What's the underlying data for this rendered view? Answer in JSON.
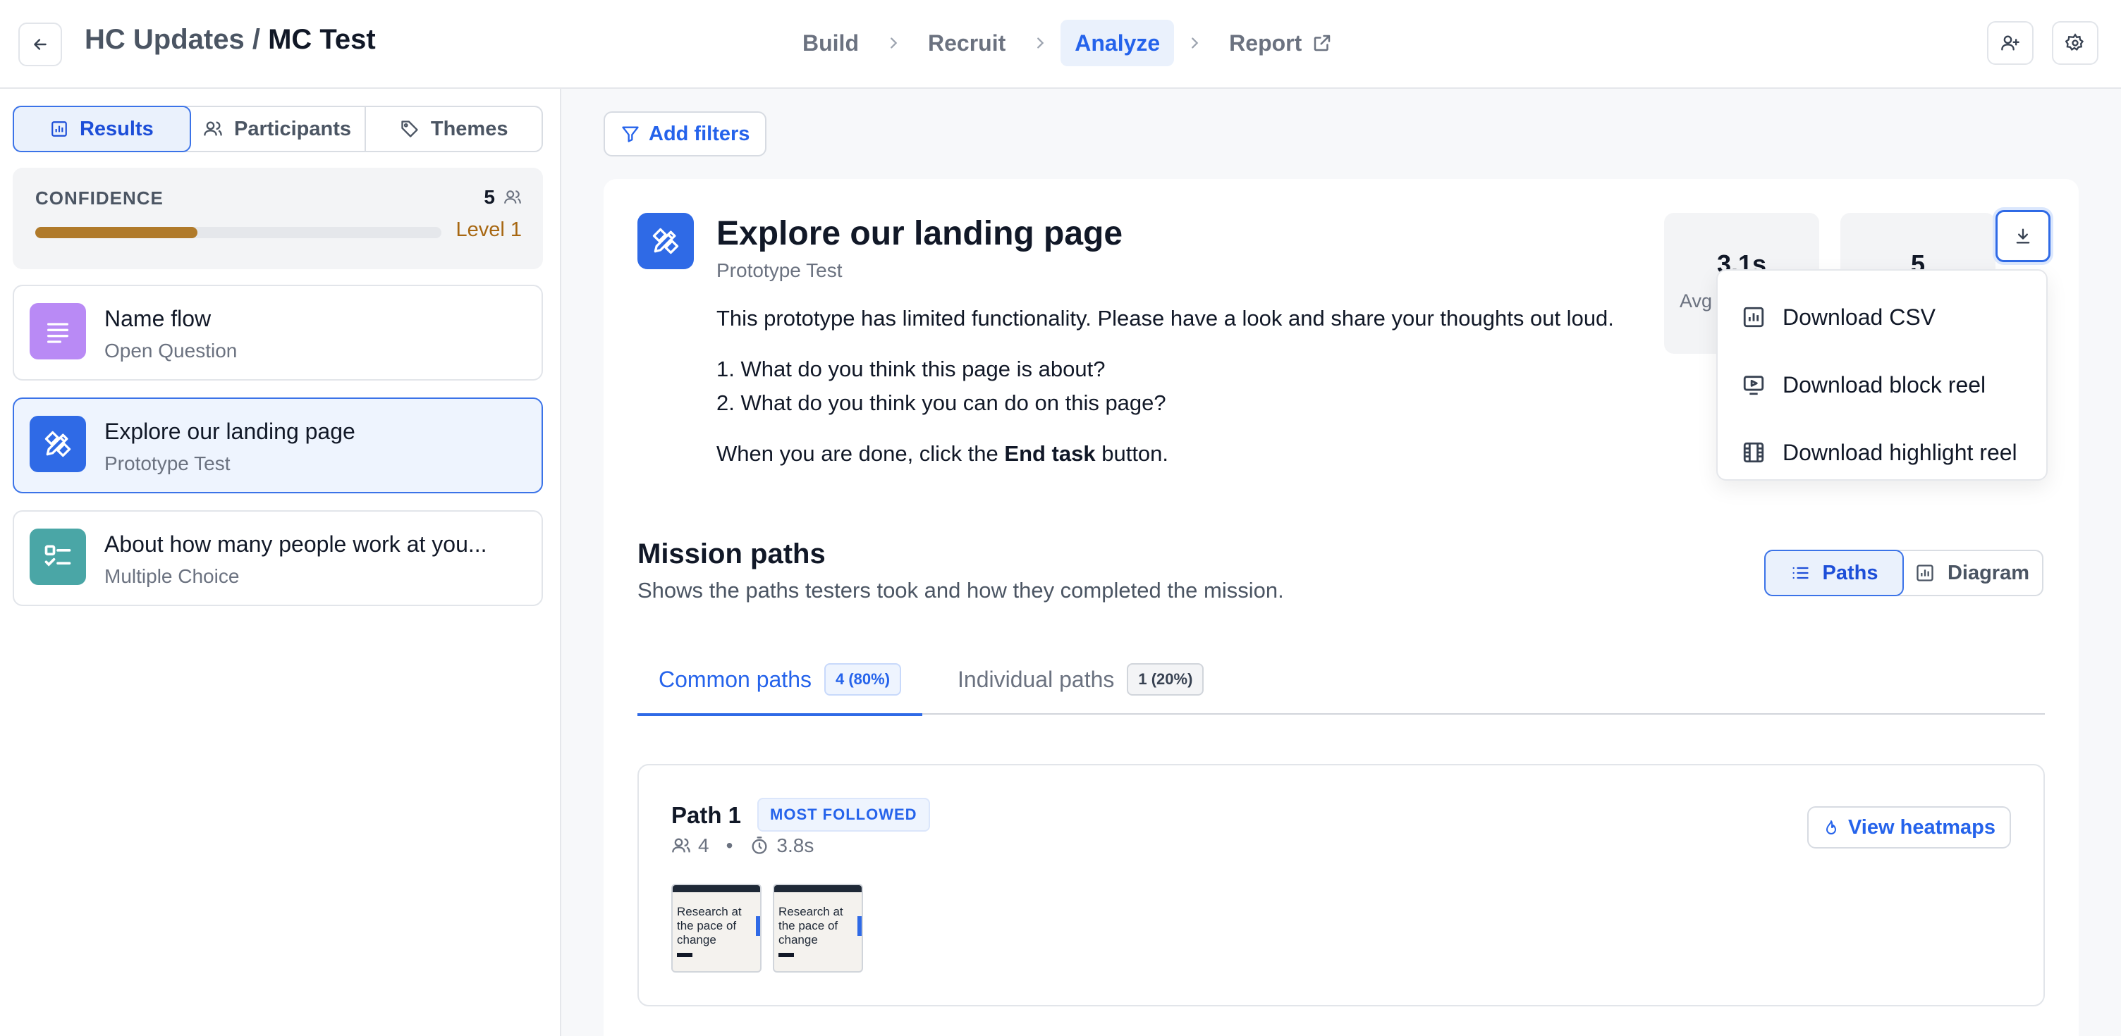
{
  "header": {
    "project": "HC Updates /",
    "study": "MC Test",
    "steps": [
      "Build",
      "Recruit",
      "Analyze",
      "Report"
    ],
    "active_step": "Analyze"
  },
  "sidebar": {
    "tabs": [
      {
        "label": "Results",
        "icon": "bar-chart-icon"
      },
      {
        "label": "Participants",
        "icon": "users-icon"
      },
      {
        "label": "Themes",
        "icon": "tag-icon"
      }
    ],
    "confidence": {
      "label": "CONFIDENCE",
      "count": "5",
      "level": "Level 1",
      "progress": 0.4
    },
    "blocks": [
      {
        "title": "Name flow",
        "subtitle": "Open Question",
        "icon": "text-lines-icon",
        "color": "#b98af5"
      },
      {
        "title": "Explore our landing page",
        "subtitle": "Prototype Test",
        "icon": "design-tools-icon",
        "color": "#2f6ae6"
      },
      {
        "title": "About how many people work at you...",
        "subtitle": "Multiple Choice",
        "icon": "checklist-icon",
        "color": "#4aa6a6"
      }
    ]
  },
  "main": {
    "add_filters": "Add filters",
    "task": {
      "title": "Explore our landing page",
      "subtitle": "Prototype Test",
      "intro": "This prototype has limited functionality. Please have a look and share your thoughts out loud.",
      "q1": "1. What do you think this page is about?",
      "q2": "2. What do you think you can do on this page?",
      "end_pre": "When you are done, click the ",
      "end_bold": "End task",
      "end_post": " button."
    },
    "stats": [
      {
        "value": "3.1s",
        "label": "Avg"
      },
      {
        "value": "5",
        "label": ""
      }
    ],
    "download_menu": [
      {
        "label": "Download CSV",
        "icon": "chart-file-icon"
      },
      {
        "label": "Download block reel",
        "icon": "video-play-icon"
      },
      {
        "label": "Download highlight reel",
        "icon": "film-icon"
      }
    ],
    "mission": {
      "title": "Mission paths",
      "subtitle": "Shows the paths testers took and how they completed the mission.",
      "view_paths": "Paths",
      "view_diagram": "Diagram"
    },
    "tabs": [
      {
        "label": "Common paths",
        "count": "4 (80%)"
      },
      {
        "label": "Individual paths",
        "count": "1 (20%)"
      }
    ],
    "path": {
      "title": "Path 1",
      "badge": "MOST FOLLOWED",
      "testers": "4",
      "separator": "•",
      "time": "3.8s",
      "heatmaps": "View heatmaps",
      "thumbnail_text": "Research at the pace of change"
    }
  },
  "colors": {
    "accent": "#2f6ae6",
    "confidence_bar": "#b07a2a",
    "level_text": "#a76712"
  }
}
